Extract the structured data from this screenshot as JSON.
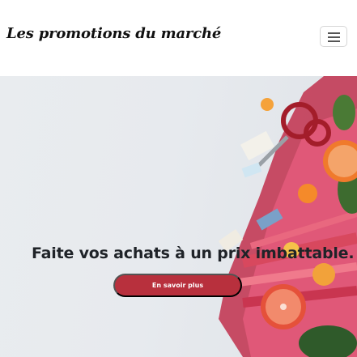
{
  "navbar": {
    "brand": "Les promotions du marché",
    "toggler_icon": "hamburger-icon"
  },
  "hero": {
    "headline": "Faite vos achats à un prix imbattable.",
    "cta_label": "En savoir plus",
    "cta_color": "#b8303d",
    "background_image": "fresh-produce-photo"
  }
}
